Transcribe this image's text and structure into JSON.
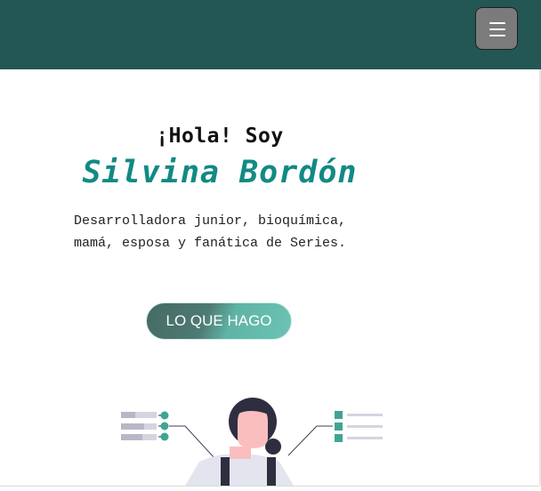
{
  "navbar": {
    "background": "#235753",
    "menu_icon": "hamburger-menu-icon"
  },
  "hero": {
    "greeting": "¡Hola! Soy",
    "name": "Silvina Bordón",
    "description_lines": [
      "Desarrolladora junior, bioquímica,",
      "mamá, esposa y fanática de Series."
    ],
    "cta_label": "LO QUE HAGO",
    "accent_color": "#128a83"
  },
  "illustration": {
    "icon": "woman-with-checklists-illustration"
  }
}
